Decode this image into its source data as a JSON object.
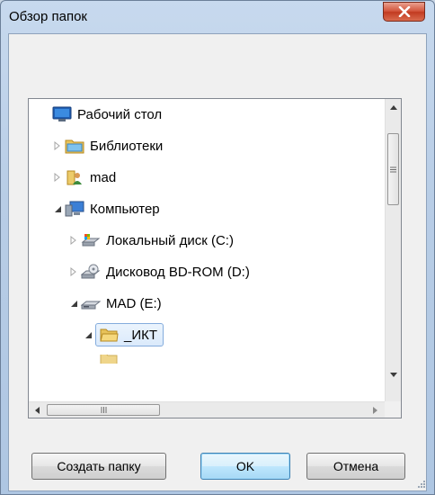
{
  "window": {
    "title": "Обзор папок",
    "close_tooltip": "Закрыть"
  },
  "tree": {
    "items": [
      {
        "label": "Рабочий стол",
        "icon": "desktop-icon",
        "expander": "none",
        "selected": false
      },
      {
        "label": "Библиотеки",
        "icon": "libraries-icon",
        "expander": "collapsed",
        "selected": false
      },
      {
        "label": "mad",
        "icon": "user-folder-icon",
        "expander": "collapsed",
        "selected": false
      },
      {
        "label": "Компьютер",
        "icon": "computer-icon",
        "expander": "expanded",
        "selected": false
      },
      {
        "label": "Локальный диск (C:)",
        "icon": "local-disk-icon",
        "expander": "collapsed",
        "selected": false
      },
      {
        "label": "Дисковод BD-ROM (D:)",
        "icon": "bd-rom-drive-icon",
        "expander": "collapsed",
        "selected": false
      },
      {
        "label": "MAD (E:)",
        "icon": "removable-drive-icon",
        "expander": "expanded",
        "selected": false
      },
      {
        "label": "_ИКТ",
        "icon": "folder-icon",
        "expander": "expanded",
        "selected": true
      }
    ]
  },
  "buttons": {
    "new_folder": "Создать папку",
    "ok": "OK",
    "cancel": "Отмена"
  },
  "colors": {
    "titlebar": "#b8cde6",
    "close": "#c23a20",
    "selection": "#dbeafb"
  }
}
